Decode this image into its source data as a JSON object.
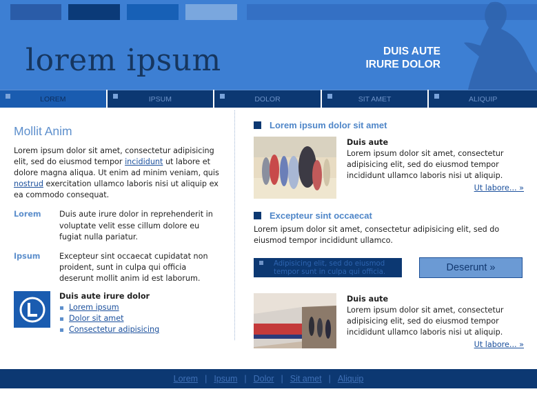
{
  "colors": {
    "header_bg": "#3d7fd3",
    "nav_bg": "#0c3872",
    "accent": "#5d8fcc",
    "footer_bg": "#0c3872"
  },
  "header": {
    "logo": "lorem ipsum",
    "tagline_line1": "DUIS AUTE",
    "tagline_line2": "IRURE DOLOR"
  },
  "nav": {
    "items": [
      {
        "label": "LOREM"
      },
      {
        "label": "IPSUM"
      },
      {
        "label": "DOLOR"
      },
      {
        "label": "SIT AMET"
      },
      {
        "label": "ALIQUIP"
      }
    ]
  },
  "left": {
    "heading": "Mollit Anim",
    "intro_part1": "Lorem ipsum dolor sit amet, consectetur adipisicing elit, sed do eiusmod tempor",
    "intro_link1": "incididunt",
    "intro_part2": "ut labore et dolore magna aliqua. Ut enim ad minim veniam, quis",
    "intro_link2": "nostrud",
    "intro_part3": "exercitation ullamco laboris nisi ut aliquip ex ea commodo consequat.",
    "defs": [
      {
        "term": "Lorem",
        "desc": "Duis aute irure dolor in reprehenderit in voluptate velit esse cillum dolore eu fugiat nulla pariatur."
      },
      {
        "term": "Ipsum",
        "desc": "Excepteur sint occaecat cupidatat non proident, sunt in culpa qui officia deserunt mollit anim id est laborum."
      }
    ],
    "box_title": "Duis aute irure dolor",
    "links": [
      "Lorem ipsum",
      "Dolor sit amet",
      "Consectetur adipisicing"
    ]
  },
  "right": {
    "section1_title": "Lorem ipsum dolor sit amet",
    "feature1_title": "Duis aute",
    "feature1_text": "Lorem ipsum dolor sit amet, consectetur adipisicing elit, sed do eiusmod tempor incididunt ullamco laboris nisi ut aliquip.",
    "feature1_more": "Ut labore... »",
    "section2_title": "Excepteur sint occaecat",
    "section2_text": "Lorem ipsum dolor sit amet, consectetur adipisicing elit, sed do eiusmod tempor incididunt ullamco.",
    "cta_text": "Adipisicing elit, sed do eiusmod tempor sunt in culpa qui officia.",
    "cta_button": "Deserunt »",
    "feature2_title": "Duis aute",
    "feature2_text": "Lorem ipsum dolor sit amet, consectetur adipisicing elit, sed do eiusmod tempor incididunt ullamco laboris nisi ut aliquip.",
    "feature2_more": "Ut labore... »"
  },
  "footer": {
    "links": [
      "Lorem",
      "Ipsum",
      "Dolor",
      "Sit amet",
      "Aliquip"
    ],
    "separator": "|"
  }
}
